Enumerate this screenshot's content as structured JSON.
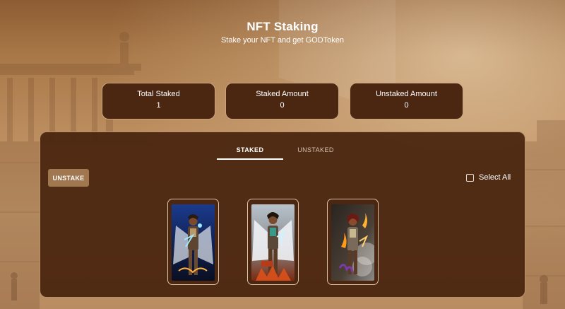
{
  "header": {
    "title": "NFT Staking",
    "subtitle": "Stake your NFT and get GODToken"
  },
  "stats": [
    {
      "label": "Total Staked",
      "value": "1"
    },
    {
      "label": "Staked Amount",
      "value": "0"
    },
    {
      "label": "Unstaked Amount",
      "value": "0"
    }
  ],
  "tabs": {
    "staked": "STAKED",
    "unstaked": "UNSTAKED",
    "active": "STAKED"
  },
  "actions": {
    "unstake_label": "UNSTAKE",
    "select_all_label": "Select All",
    "select_all_checked": false
  },
  "nfts": [
    {
      "name": "winged-warrior-blue"
    },
    {
      "name": "winged-warrior-fire"
    },
    {
      "name": "warrior-dark-smoke"
    }
  ],
  "colors": {
    "card_bg": "#4b2712",
    "card_border": "#c9a27c",
    "panel_bg": "#48240e",
    "button_bg": "#a0774f",
    "text": "#ffffff"
  }
}
